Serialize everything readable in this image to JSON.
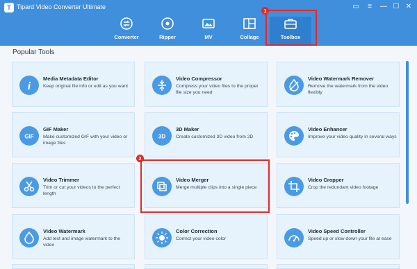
{
  "window": {
    "title": "Tipard Video Converter Ultimate",
    "logo_letter": "T"
  },
  "controls": {
    "chat": "▭",
    "menu": "≡",
    "minimize": "—",
    "maximize": "☐",
    "close": "✕"
  },
  "nav": {
    "tabs": [
      {
        "label": "Converter",
        "icon": "converter-icon"
      },
      {
        "label": "Ripper",
        "icon": "ripper-icon"
      },
      {
        "label": "MV",
        "icon": "mv-icon"
      },
      {
        "label": "Collage",
        "icon": "collage-icon"
      },
      {
        "label": "Toolbox",
        "icon": "toolbox-icon",
        "active": true
      }
    ]
  },
  "annotations": {
    "step1": "1",
    "step2": "2",
    "highlight_color": "#e02a2a"
  },
  "section": {
    "title": "Popular Tools"
  },
  "tools": [
    {
      "title": "Media Metadata Editor",
      "desc": "Keep original file info or edit as you want",
      "icon": "info-icon"
    },
    {
      "title": "Video Compressor",
      "desc": "Compress your video files to the proper file size you need",
      "icon": "compress-icon"
    },
    {
      "title": "Video Watermark Remover",
      "desc": "Remove the watermark from the video flexibly",
      "icon": "watermark-remove-icon"
    },
    {
      "title": "GIF Maker",
      "desc": "Make customized GIF with your video or image files",
      "icon": "gif-icon",
      "icon_text": "GIF"
    },
    {
      "title": "3D Maker",
      "desc": "Create customized 3D video from 2D",
      "icon": "3d-icon",
      "icon_text": "3D"
    },
    {
      "title": "Video Enhancer",
      "desc": "Improve your video quality in several ways",
      "icon": "palette-icon"
    },
    {
      "title": "Video Trimmer",
      "desc": "Trim or cut your videos to the perfect length",
      "icon": "scissors-icon"
    },
    {
      "title": "Video Merger",
      "desc": "Merge multiple clips into a single piece",
      "icon": "merge-icon"
    },
    {
      "title": "Video Cropper",
      "desc": "Crop the redundant video footage",
      "icon": "crop-icon"
    },
    {
      "title": "Video Watermark",
      "desc": "Add text and image watermark to the video",
      "icon": "droplet-icon"
    },
    {
      "title": "Color Correction",
      "desc": "Correct your video color",
      "icon": "sun-icon"
    },
    {
      "title": "Video Speed Controller",
      "desc": "Speed up or slow down your file at ease",
      "icon": "speed-icon"
    }
  ],
  "colors": {
    "topbar": "#3f8fdc",
    "card_bg": "#e6f2fc",
    "icon_bg": "#4a9ae4",
    "accent_red": "#e02a2a"
  }
}
